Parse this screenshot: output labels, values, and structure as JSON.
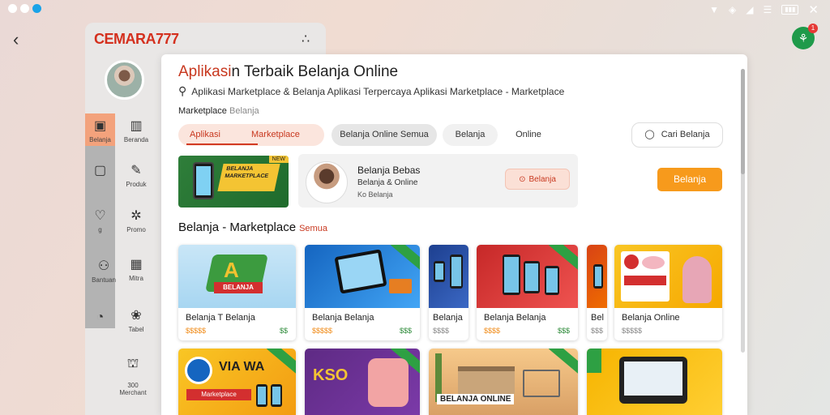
{
  "status_bar": {
    "battery": "▮▮▮"
  },
  "bg_window": {
    "brand": "CEMARA777",
    "more": "∴",
    "sidebar": [
      {
        "label": "Belanja",
        "icon": "cart-icon"
      },
      {
        "label": "Beranda",
        "icon": "book-icon"
      },
      {
        "label": "",
        "icon": "chat-icon"
      },
      {
        "label": "Produk",
        "icon": "tag-icon"
      },
      {
        "label": "g",
        "icon": "shield-icon"
      },
      {
        "label": "Promo",
        "icon": "star-icon"
      },
      {
        "label": "Bantuan",
        "icon": "people-icon"
      },
      {
        "label": "Mitra",
        "icon": "grid-icon"
      },
      {
        "label": "",
        "icon": "clock-icon"
      },
      {
        "label": "Tabel",
        "icon": "flower-icon"
      },
      {
        "label": "300\nMerchant",
        "icon": "stand-icon"
      }
    ]
  },
  "header": {
    "title_part1": "Aplikasi",
    "title_part2": "n Terbaik Belanja Online",
    "search_text": "Aplikasi Marketplace & Belanja Aplikasi Terpercaya  Aplikasi Marketplace - Marketplace",
    "breadcrumb": "Marketplace",
    "breadcrumb_sub": "Belanja"
  },
  "tabs": [
    {
      "label": "Aplikasi",
      "active": true
    },
    {
      "label": "Marketplace"
    },
    {
      "label": "Belanja Online Semua"
    },
    {
      "label": "Belanja"
    },
    {
      "label": "Online"
    }
  ],
  "filter_button": "Cari Belanja",
  "banner": {
    "text": "BELANJA MARKETPLACE",
    "tag": "NEW"
  },
  "promo": {
    "title": "Belanja Bebas",
    "subtitle": "Belanja & Online",
    "meta": "Ko Belanja",
    "button": "Belanja"
  },
  "orange_button": "Belanja",
  "section": {
    "title": "Belanja - Marketplace",
    "suffix": "Semua"
  },
  "cards": [
    {
      "title": "Belanja T Belanja",
      "price": "$$$$$",
      "price2": "$$"
    },
    {
      "title": "Belanja Belanja",
      "price": "$$$$$",
      "price2": "$$$"
    },
    {
      "title": "Belanja",
      "price": "$$$$",
      "price2": ""
    },
    {
      "title": "Belanja Belanja",
      "price": "$$$$",
      "price2": "$$$"
    },
    {
      "title": "Bel",
      "price": "$$$",
      "price2": ""
    },
    {
      "title": "Belanja Online",
      "price": "$$$$$",
      "price2": ""
    }
  ],
  "cards_row2": [
    {
      "text": "VIA WA"
    },
    {
      "text": "KSO"
    },
    {
      "text": "BELANJA ONLINE"
    },
    {
      "text": ""
    }
  ],
  "colors": {
    "accent": "#c8381f",
    "orange": "#f79a1c",
    "green": "#2ea043"
  }
}
